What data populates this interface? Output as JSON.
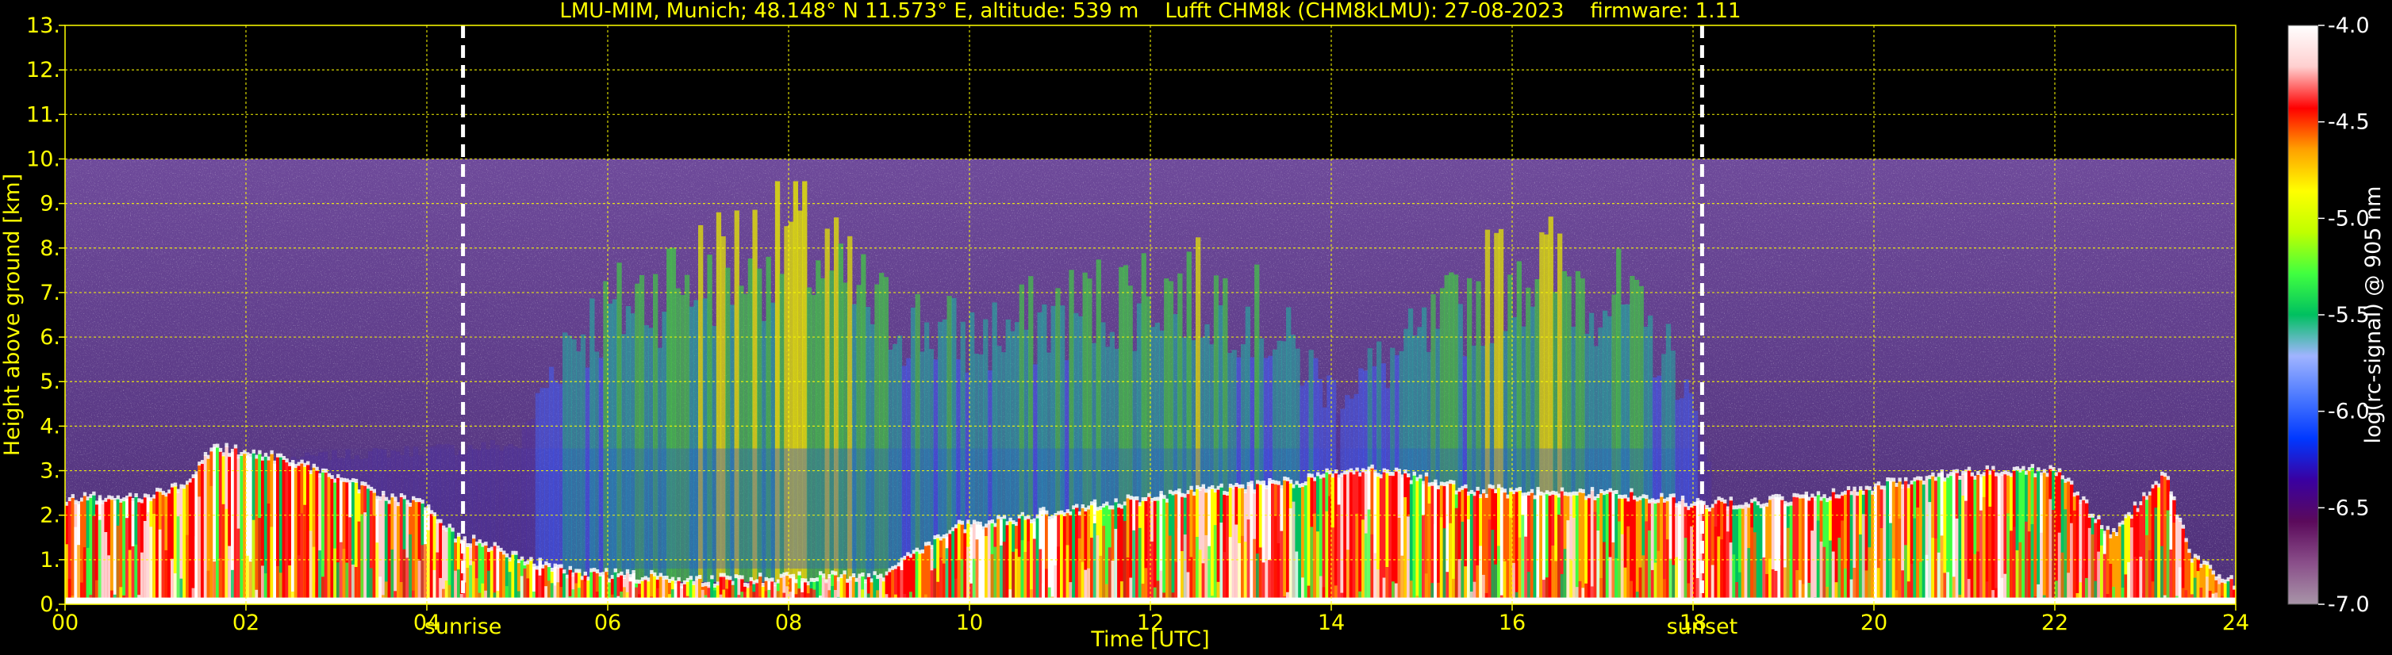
{
  "chart_data": {
    "type": "heatmap",
    "title": "LMU-MIM, Munich; 48.148° N 11.573° E, altitude: 539 m    Lufft CHM8k (CHM8kLMU): 27-08-2023    firmware: 1.11",
    "xlabel": "Time [UTC]",
    "ylabel": "Height above ground [km]",
    "xlim": [
      0,
      24
    ],
    "ylim": [
      0,
      13
    ],
    "x_ticks": [
      "00",
      "02",
      "04",
      "06",
      "08",
      "10",
      "12",
      "14",
      "16",
      "18",
      "20",
      "22",
      "24"
    ],
    "y_ticks": [
      "0.",
      "1.",
      "2.",
      "3.",
      "4.",
      "5.",
      "6.",
      "7.",
      "8.",
      "9.",
      "10.",
      "11.",
      "12.",
      "13."
    ],
    "grid": true,
    "colorbar": {
      "label": "log(rc-signal) @ 905 nm",
      "range": [
        -7.0,
        -4.0
      ],
      "ticks": [
        "-7.0",
        "-6.5",
        "-6.0",
        "-5.5",
        "-5.0",
        "-4.5",
        "-4.0"
      ],
      "colors": [
        "#a895a8",
        "#8a4f8a",
        "#5b0a5b",
        "#3a00a0",
        "#0038ff",
        "#4a78ff",
        "#a0b4ff",
        "#00c060",
        "#40ff40",
        "#c0ff00",
        "#ffff00",
        "#ffa000",
        "#ff0000",
        "#ffd0d0",
        "#ffffff"
      ]
    },
    "data_ceiling_km": 10,
    "events": [
      {
        "label": "sunrise",
        "time_h": 4.4
      },
      {
        "label": "sunset",
        "time_h": 18.1
      }
    ],
    "boundary_layer_top_km": [
      [
        0,
        2.3
      ],
      [
        0.8,
        2.4
      ],
      [
        1.3,
        2.6
      ],
      [
        1.6,
        3.5
      ],
      [
        2.5,
        3.2
      ],
      [
        3.5,
        2.4
      ],
      [
        4.0,
        2.2
      ],
      [
        4.3,
        1.5
      ],
      [
        5.5,
        0.7
      ],
      [
        7.0,
        0.5
      ],
      [
        9.0,
        0.6
      ],
      [
        9.8,
        1.7
      ],
      [
        10.5,
        1.9
      ],
      [
        11.5,
        2.2
      ],
      [
        12.5,
        2.5
      ],
      [
        13.5,
        2.7
      ],
      [
        14.2,
        3.0
      ],
      [
        15.0,
        2.8
      ],
      [
        15.5,
        2.5
      ],
      [
        16.5,
        2.5
      ],
      [
        17.5,
        2.4
      ],
      [
        18.1,
        2.2
      ],
      [
        19.5,
        2.4
      ],
      [
        20.5,
        2.8
      ],
      [
        21.0,
        2.9
      ],
      [
        22.0,
        3.0
      ],
      [
        22.6,
        1.5
      ],
      [
        23.2,
        2.9
      ],
      [
        23.5,
        1.0
      ],
      [
        24,
        0.4
      ]
    ],
    "aerosol_plume_intensity": [
      [
        0,
        0.0
      ],
      [
        5.0,
        0.1
      ],
      [
        5.5,
        0.5
      ],
      [
        6.5,
        0.7
      ],
      [
        8.0,
        0.9
      ],
      [
        9.0,
        0.6
      ],
      [
        10.0,
        0.5
      ],
      [
        11.0,
        0.6
      ],
      [
        12.0,
        0.7
      ],
      [
        13.0,
        0.65
      ],
      [
        14.0,
        0.3
      ],
      [
        15.0,
        0.5
      ],
      [
        16.0,
        0.8
      ],
      [
        17.0,
        0.7
      ],
      [
        17.8,
        0.4
      ],
      [
        18.2,
        0.0
      ],
      [
        24,
        0.0
      ]
    ]
  }
}
